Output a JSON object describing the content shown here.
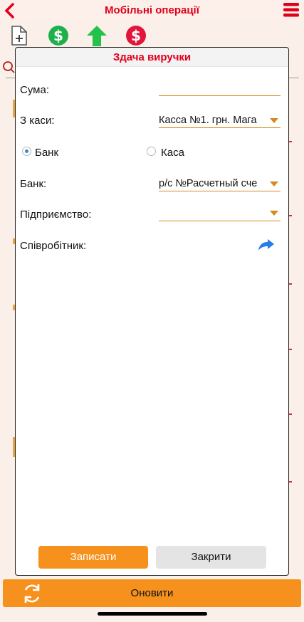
{
  "header": {
    "title": "Мобільні операції",
    "back_icon": "chevron-left-icon",
    "menu_icon": "hamburger-menu-icon"
  },
  "toolbar": {
    "icons": [
      "new-document-icon",
      "dollar-green-icon",
      "upload-arrow-icon",
      "dollar-red-icon"
    ]
  },
  "modal": {
    "title": "Здача виручки",
    "fields": {
      "amount_label": "Сума:",
      "amount_value": "",
      "from_cash_label": "З каси:",
      "from_cash_value": "Касса №1. грн. Мага",
      "radio_bank_label": "Банк",
      "radio_cash_label": "Каса",
      "selected_radio": "Банк",
      "bank_label": "Банк:",
      "bank_value": "р/с №Расчетный сче",
      "enterprise_label": "Підприємство:",
      "enterprise_value": "",
      "employee_label": "Співробітник:"
    },
    "buttons": {
      "save": "Записати",
      "close": "Закрити"
    }
  },
  "refresh": {
    "label": "Оновити",
    "icon": "refresh-icon"
  },
  "colors": {
    "accent": "#f7911e",
    "title_red": "#e0001b",
    "field_line": "#d48a1c",
    "radio_blue": "#3a86d8"
  }
}
